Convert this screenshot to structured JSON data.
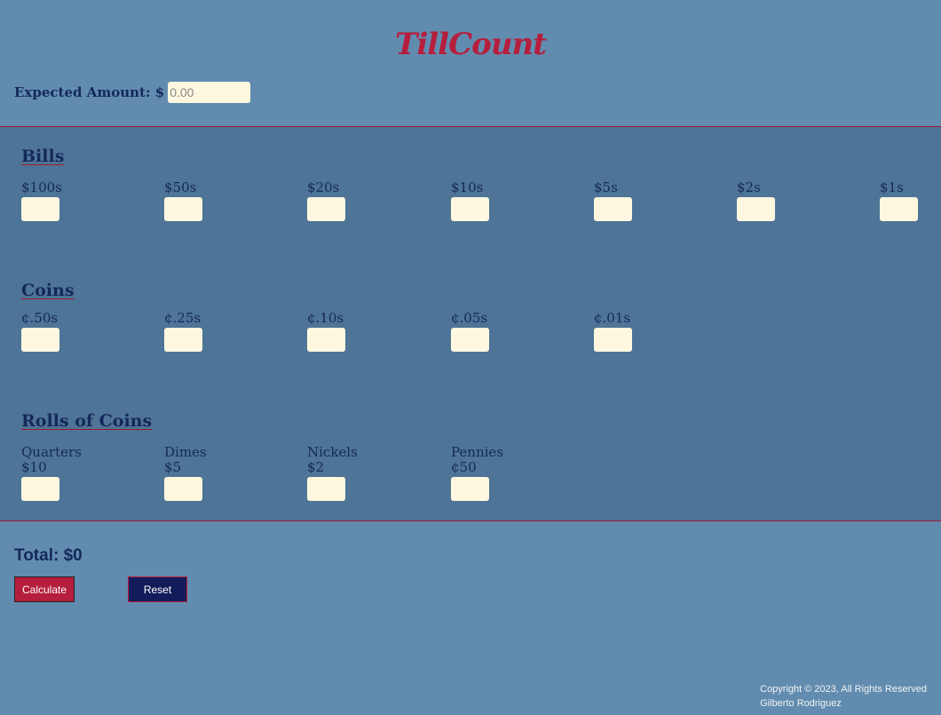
{
  "header": {
    "title": "TillCount",
    "expected_label": "Expected Amount: $",
    "expected_placeholder": "0.00"
  },
  "bills": {
    "title": "Bills",
    "items": [
      {
        "label": "$100s"
      },
      {
        "label": "$50s"
      },
      {
        "label": "$20s"
      },
      {
        "label": "$10s"
      },
      {
        "label": "$5s"
      },
      {
        "label": "$2s"
      },
      {
        "label": "$1s"
      }
    ]
  },
  "coins": {
    "title": "Coins",
    "items": [
      {
        "label": "¢.50s"
      },
      {
        "label": "¢.25s"
      },
      {
        "label": "¢.10s"
      },
      {
        "label": "¢.05s"
      },
      {
        "label": "¢.01s"
      }
    ]
  },
  "rolls": {
    "title": "Rolls of Coins",
    "items": [
      {
        "name": "Quarters",
        "value": "$10"
      },
      {
        "name": "Dimes",
        "value": "$5"
      },
      {
        "name": "Nickels",
        "value": "$2"
      },
      {
        "name": "Pennies",
        "value": "¢50"
      }
    ]
  },
  "summary": {
    "total": "Total: $0",
    "calculate_label": "Calculate",
    "reset_label": "Reset"
  },
  "footer": {
    "copyright": "Copyright © 2023, All Rights Reserved",
    "author": "Gilberto Rodriguez"
  },
  "colors": {
    "page_bg": "#618caf",
    "section_bg": "#4e7497",
    "accent": "#b51e3c",
    "navy": "#15285a",
    "input_bg": "#fff8e0"
  }
}
